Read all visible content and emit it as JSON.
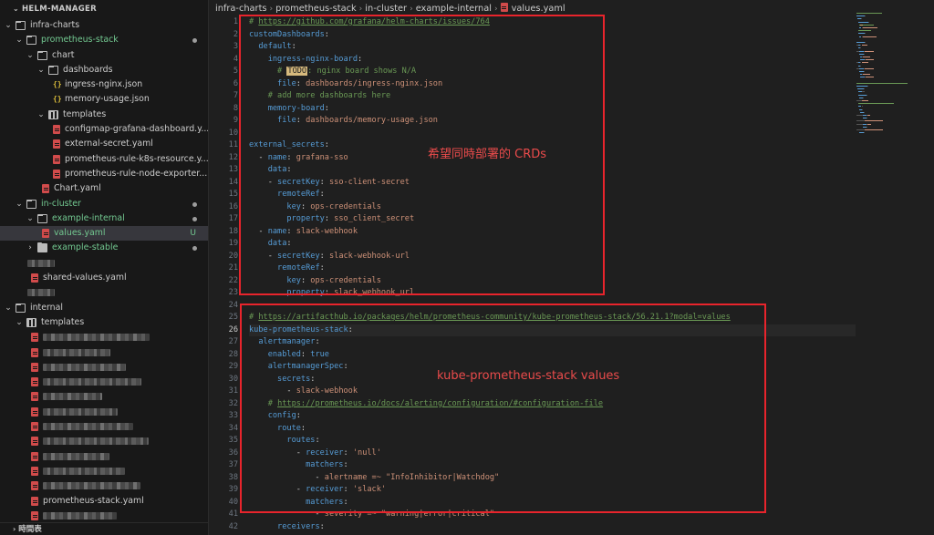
{
  "sidebar": {
    "header": "HELM-MANAGER",
    "footer": "時間表",
    "rows": [
      {
        "depth": 0,
        "type": "folder",
        "open": true,
        "label": "infra-charts",
        "color": "default"
      },
      {
        "depth": 1,
        "type": "folder",
        "open": true,
        "label": "prometheus-stack",
        "color": "green",
        "dot": true
      },
      {
        "depth": 2,
        "type": "folder",
        "open": true,
        "label": "chart",
        "color": "default"
      },
      {
        "depth": 3,
        "type": "folder",
        "open": true,
        "label": "dashboards",
        "color": "default"
      },
      {
        "depth": 4,
        "type": "json",
        "label": "ingress-nginx.json",
        "color": "default"
      },
      {
        "depth": 4,
        "type": "json",
        "label": "memory-usage.json",
        "color": "default"
      },
      {
        "depth": 3,
        "type": "folder",
        "open": true,
        "label": "templates",
        "color": "default",
        "dots": true
      },
      {
        "depth": 4,
        "type": "yaml",
        "label": "configmap-grafana-dashboard.y...",
        "color": "default"
      },
      {
        "depth": 4,
        "type": "yaml",
        "label": "external-secret.yaml",
        "color": "default"
      },
      {
        "depth": 4,
        "type": "yaml",
        "label": "prometheus-rule-k8s-resource.y...",
        "color": "default"
      },
      {
        "depth": 4,
        "type": "yaml",
        "label": "prometheus-rule-node-exporter....",
        "color": "default"
      },
      {
        "depth": 3,
        "type": "yaml",
        "label": "Chart.yaml",
        "color": "default"
      },
      {
        "depth": 1,
        "type": "folder",
        "open": true,
        "label": "in-cluster",
        "color": "green",
        "dot": true
      },
      {
        "depth": 2,
        "type": "folder",
        "open": true,
        "label": "example-internal",
        "color": "green",
        "dot": true
      },
      {
        "depth": 3,
        "type": "yaml",
        "label": "values.yaml",
        "color": "green",
        "badge": "U",
        "selected": true
      },
      {
        "depth": 2,
        "type": "folder",
        "open": false,
        "label": "example-stable",
        "color": "green",
        "dot": true
      },
      {
        "depth": 1,
        "type": "blur",
        "label": ""
      },
      {
        "depth": 2,
        "type": "yaml",
        "label": "shared-values.yaml",
        "color": "default"
      },
      {
        "depth": 1,
        "type": "blur",
        "label": ""
      },
      {
        "depth": 0,
        "type": "folder",
        "open": true,
        "label": "internal",
        "color": "default"
      },
      {
        "depth": 1,
        "type": "folder",
        "open": true,
        "label": "templates",
        "color": "default",
        "dots": true
      },
      {
        "depth": 2,
        "type": "yamlblur",
        "label": ""
      },
      {
        "depth": 2,
        "type": "yamlblur",
        "label": ""
      },
      {
        "depth": 2,
        "type": "yamlblur",
        "label": ""
      },
      {
        "depth": 2,
        "type": "yamlblur",
        "label": ""
      },
      {
        "depth": 2,
        "type": "yamlblur",
        "label": ""
      },
      {
        "depth": 2,
        "type": "yamlblur",
        "label": ""
      },
      {
        "depth": 2,
        "type": "yamlblur",
        "label": ""
      },
      {
        "depth": 2,
        "type": "yamlblur",
        "label": ""
      },
      {
        "depth": 2,
        "type": "yamlblur",
        "label": ""
      },
      {
        "depth": 2,
        "type": "yamlblur",
        "label": ""
      },
      {
        "depth": 2,
        "type": "yamlblur",
        "label": ""
      },
      {
        "depth": 2,
        "type": "yaml",
        "label": "prometheus-stack.yaml",
        "color": "default"
      },
      {
        "depth": 2,
        "type": "yamlblur",
        "label": ""
      }
    ]
  },
  "breadcrumb": [
    "infra-charts",
    "prometheus-stack",
    "in-cluster",
    "example-internal",
    "values.yaml"
  ],
  "editor": {
    "current_line": 26,
    "lines": [
      [
        [
          "c",
          "# "
        ],
        [
          "cu",
          "https://github.com/grafana/helm-charts/issues/764"
        ]
      ],
      [
        [
          "k",
          "customDashboards"
        ],
        [
          "p",
          ":"
        ]
      ],
      [
        [
          "p",
          "  "
        ],
        [
          "k",
          "default"
        ],
        [
          "p",
          ":"
        ]
      ],
      [
        [
          "p",
          "    "
        ],
        [
          "k",
          "ingress-nginx-board"
        ],
        [
          "p",
          ":"
        ]
      ],
      [
        [
          "p",
          "      "
        ],
        [
          "c",
          "# "
        ],
        [
          "todo",
          "TODO"
        ],
        [
          "c",
          ": nginx board shows N/A"
        ]
      ],
      [
        [
          "p",
          "      "
        ],
        [
          "k",
          "file"
        ],
        [
          "p",
          ": "
        ],
        [
          "s",
          "dashboards/ingress-nginx.json"
        ]
      ],
      [
        [
          "p",
          "    "
        ],
        [
          "c",
          "# add more dashboards here"
        ]
      ],
      [
        [
          "p",
          "    "
        ],
        [
          "k",
          "memory-board"
        ],
        [
          "p",
          ":"
        ]
      ],
      [
        [
          "p",
          "      "
        ],
        [
          "k",
          "file"
        ],
        [
          "p",
          ": "
        ],
        [
          "s",
          "dashboards/memory-usage.json"
        ]
      ],
      [],
      [
        [
          "k",
          "external_secrets"
        ],
        [
          "p",
          ":"
        ]
      ],
      [
        [
          "p",
          "  - "
        ],
        [
          "k",
          "name"
        ],
        [
          "p",
          ": "
        ],
        [
          "s",
          "grafana-sso"
        ]
      ],
      [
        [
          "p",
          "    "
        ],
        [
          "k",
          "data"
        ],
        [
          "p",
          ":"
        ]
      ],
      [
        [
          "p",
          "    - "
        ],
        [
          "k",
          "secretKey"
        ],
        [
          "p",
          ": "
        ],
        [
          "s",
          "sso-client-secret"
        ]
      ],
      [
        [
          "p",
          "      "
        ],
        [
          "k",
          "remoteRef"
        ],
        [
          "p",
          ":"
        ]
      ],
      [
        [
          "p",
          "        "
        ],
        [
          "k",
          "key"
        ],
        [
          "p",
          ": "
        ],
        [
          "s",
          "ops-credentials"
        ]
      ],
      [
        [
          "p",
          "        "
        ],
        [
          "k",
          "property"
        ],
        [
          "p",
          ": "
        ],
        [
          "s",
          "sso_client_secret"
        ]
      ],
      [
        [
          "p",
          "  - "
        ],
        [
          "k",
          "name"
        ],
        [
          "p",
          ": "
        ],
        [
          "s",
          "slack-webhook"
        ]
      ],
      [
        [
          "p",
          "    "
        ],
        [
          "k",
          "data"
        ],
        [
          "p",
          ":"
        ]
      ],
      [
        [
          "p",
          "    - "
        ],
        [
          "k",
          "secretKey"
        ],
        [
          "p",
          ": "
        ],
        [
          "s",
          "slack-webhook-url"
        ]
      ],
      [
        [
          "p",
          "      "
        ],
        [
          "k",
          "remoteRef"
        ],
        [
          "p",
          ":"
        ]
      ],
      [
        [
          "p",
          "        "
        ],
        [
          "k",
          "key"
        ],
        [
          "p",
          ": "
        ],
        [
          "s",
          "ops-credentials"
        ]
      ],
      [
        [
          "p",
          "        "
        ],
        [
          "k",
          "property"
        ],
        [
          "p",
          ": "
        ],
        [
          "s",
          "slack_webhook_url"
        ]
      ],
      [],
      [
        [
          "c",
          "# "
        ],
        [
          "cu",
          "https://artifacthub.io/packages/helm/prometheus-community/kube-prometheus-stack/56.21.1?modal=values"
        ]
      ],
      [
        [
          "k",
          "kube-prometheus-stack"
        ],
        [
          "p",
          ":"
        ]
      ],
      [
        [
          "p",
          "  "
        ],
        [
          "k",
          "alertmanager"
        ],
        [
          "p",
          ":"
        ]
      ],
      [
        [
          "p",
          "    "
        ],
        [
          "k",
          "enabled"
        ],
        [
          "p",
          ": "
        ],
        [
          "b",
          "true"
        ]
      ],
      [
        [
          "p",
          "    "
        ],
        [
          "k",
          "alertmanagerSpec"
        ],
        [
          "p",
          ":"
        ]
      ],
      [
        [
          "p",
          "      "
        ],
        [
          "k",
          "secrets"
        ],
        [
          "p",
          ":"
        ]
      ],
      [
        [
          "p",
          "        - "
        ],
        [
          "s",
          "slack-webhook"
        ]
      ],
      [
        [
          "p",
          "    "
        ],
        [
          "c",
          "# "
        ],
        [
          "cu",
          "https://prometheus.io/docs/alerting/configuration/#configuration-file"
        ]
      ],
      [
        [
          "p",
          "    "
        ],
        [
          "k",
          "config"
        ],
        [
          "p",
          ":"
        ]
      ],
      [
        [
          "p",
          "      "
        ],
        [
          "k",
          "route"
        ],
        [
          "p",
          ":"
        ]
      ],
      [
        [
          "p",
          "        "
        ],
        [
          "k",
          "routes"
        ],
        [
          "p",
          ":"
        ]
      ],
      [
        [
          "p",
          "          - "
        ],
        [
          "k",
          "receiver"
        ],
        [
          "p",
          ": "
        ],
        [
          "s",
          "'null'"
        ]
      ],
      [
        [
          "p",
          "            "
        ],
        [
          "k",
          "matchers"
        ],
        [
          "p",
          ":"
        ]
      ],
      [
        [
          "p",
          "              - "
        ],
        [
          "s",
          "alertname =~ \"InfoInhibitor|Watchdog\""
        ]
      ],
      [
        [
          "p",
          "          - "
        ],
        [
          "k",
          "receiver"
        ],
        [
          "p",
          ": "
        ],
        [
          "s",
          "'slack'"
        ]
      ],
      [
        [
          "p",
          "            "
        ],
        [
          "k",
          "matchers"
        ],
        [
          "p",
          ":"
        ]
      ],
      [
        [
          "p",
          "              - "
        ],
        [
          "s",
          "severity =~ \"warning|error|critical\""
        ]
      ],
      [
        [
          "p",
          "      "
        ],
        [
          "k",
          "receivers"
        ],
        [
          "p",
          ":"
        ]
      ]
    ]
  },
  "annotations": {
    "crds": "希望同時部署的 CRDs",
    "values": "kube-prometheus-stack values"
  }
}
